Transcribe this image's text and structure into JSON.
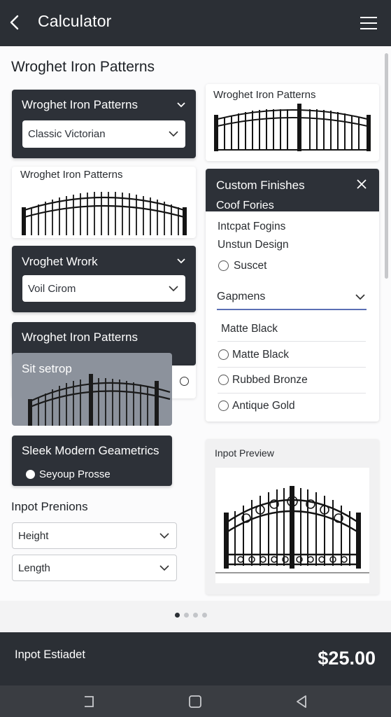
{
  "header": {
    "title": "Calculator",
    "back_icon": "chevron-left-icon",
    "menu_icon": "hamburger-icon"
  },
  "page_title": "Wroghet Iron Patterns",
  "card1": {
    "header": "Wroghet Iron Patterns",
    "selected": "Classic Victorian"
  },
  "thumb1": {
    "label": "Wroghet Iron Patterns"
  },
  "thumb2": {
    "label": "Wroghet Iron Patterns"
  },
  "card2": {
    "header": "Vroghet Wrork",
    "selected": "Voil Cirom"
  },
  "card3": {
    "header": "Wroghet Iron Patterns"
  },
  "overlay": {
    "label": "Sit setrop"
  },
  "sleek_card": {
    "title": "Sleek Modern Geametrics",
    "option": "Seyoup Prosse"
  },
  "finishes_panel": {
    "title": "Custom Finishes",
    "subtitle": "Coof Fories",
    "line1": "Intcpat Fogins",
    "line2": "Unstun Design",
    "radio1": "Suscet",
    "dropdown_value": "Gapmens",
    "plain_item": "Matte Black",
    "options": [
      "Matte Black",
      "Rubbed Bronze",
      "Antique Gold"
    ]
  },
  "input_section": {
    "label": "Inpot Prenions",
    "fields": [
      "Height",
      "Length"
    ]
  },
  "preview": {
    "label": "Inpot Preview"
  },
  "pager": {
    "count": 4,
    "active": 0
  },
  "footer": {
    "label": "Inpot Estiadet",
    "price": "$25.00"
  },
  "colors": {
    "dark": "#2b2f35",
    "accent_underline": "#5b6fb5",
    "content_bg": "#fbfbfc"
  }
}
